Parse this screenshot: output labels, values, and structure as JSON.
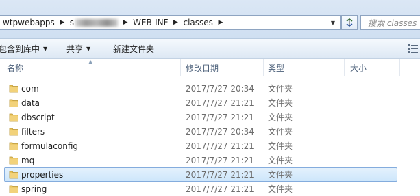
{
  "address": {
    "crumbs": [
      "wtpwebapps",
      "s",
      "WEB-INF",
      "classes"
    ]
  },
  "search": {
    "placeholder": "搜索 classes"
  },
  "toolbar": {
    "include_library": "包含到库中",
    "share": "共享",
    "new_folder": "新建文件夹"
  },
  "columns": {
    "name": "名称",
    "modified": "修改日期",
    "type": "类型",
    "size": "大小"
  },
  "files": [
    {
      "name": "com",
      "date": "2017/7/27 20:34",
      "type": "文件夹",
      "selected": false
    },
    {
      "name": "data",
      "date": "2017/7/27 21:21",
      "type": "文件夹",
      "selected": false
    },
    {
      "name": "dbscript",
      "date": "2017/7/27 21:21",
      "type": "文件夹",
      "selected": false
    },
    {
      "name": "filters",
      "date": "2017/7/27 20:34",
      "type": "文件夹",
      "selected": false
    },
    {
      "name": "formulaconfig",
      "date": "2017/7/27 21:21",
      "type": "文件夹",
      "selected": false
    },
    {
      "name": "mq",
      "date": "2017/7/27 21:21",
      "type": "文件夹",
      "selected": false
    },
    {
      "name": "properties",
      "date": "2017/7/27 21:21",
      "type": "文件夹",
      "selected": true
    },
    {
      "name": "spring",
      "date": "2017/7/27 21:21",
      "type": "文件夹",
      "selected": false
    }
  ],
  "colors": {
    "selection_fill": "#cde6fb",
    "selection_border": "#84acdd",
    "folder": "#e8c25a"
  }
}
